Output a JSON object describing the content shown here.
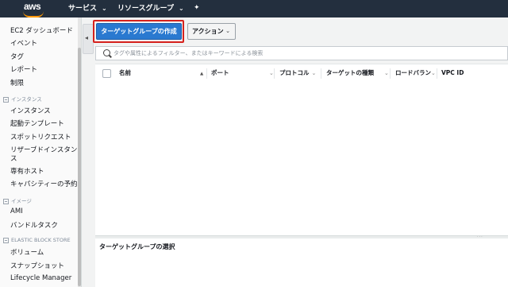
{
  "topbar": {
    "logo": "aws",
    "services": "サービス",
    "resource_groups": "リソースグループ",
    "chevron": "⌄",
    "pin": "✦"
  },
  "sidebar": {
    "items": [
      {
        "label": "EC2 ダッシュボード"
      },
      {
        "label": "イベント"
      },
      {
        "label": "タグ"
      },
      {
        "label": "レポート"
      },
      {
        "label": "制限"
      }
    ],
    "instances_section": "インスタンス",
    "instances_items": [
      {
        "label": "インスタンス"
      },
      {
        "label": "起動テンプレート"
      },
      {
        "label": "スポットリクエスト"
      },
      {
        "label": "リザーブドインスタン"
      },
      {
        "label": "ス"
      },
      {
        "label": "専有ホスト"
      },
      {
        "label": "キャパシティーの予約"
      }
    ],
    "images_section": "イメージ",
    "images_items": [
      {
        "label": "AMI"
      },
      {
        "label": "バンドルタスク"
      }
    ],
    "ebs_section": "ELASTIC BLOCK STORE",
    "ebs_items": [
      {
        "label": "ボリューム"
      },
      {
        "label": "スナップショット"
      },
      {
        "label": "Lifecycle Manager"
      }
    ]
  },
  "toolbar": {
    "create_button": "ターゲットグループの作成",
    "action_button": "アクション"
  },
  "search": {
    "placeholder": "タグや属性によるフィルター、またはキーワードによる検索"
  },
  "table": {
    "columns": [
      "名前",
      "ポート",
      "プロトコル",
      "ターゲットの種類",
      "ロードバラン",
      "VPC ID"
    ]
  },
  "detail": {
    "title": "ターゲットグループの選択"
  }
}
